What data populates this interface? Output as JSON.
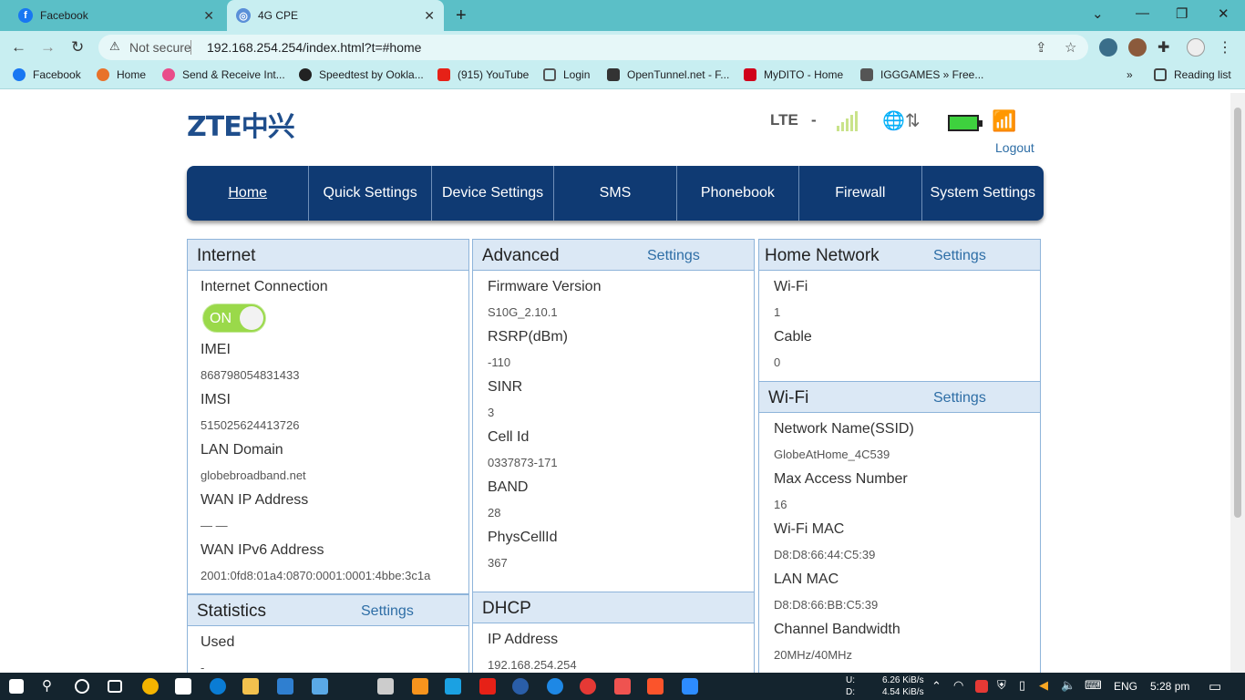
{
  "browser": {
    "tabs": [
      {
        "title": "Facebook",
        "active": false
      },
      {
        "title": "4G CPE",
        "active": true
      }
    ],
    "address": {
      "security": "Not secure",
      "url": "192.168.254.254/index.html?t=#home"
    },
    "bookmarks": [
      "Facebook",
      "Home",
      "Send & Receive Int...",
      "Speedtest by Ookla...",
      "(915) YouTube",
      "Login",
      "OpenTunnel.net - F...",
      "MyDITO - Home",
      "IGGGAMES » Free..."
    ],
    "reading_list": "Reading list"
  },
  "router": {
    "brand": "ZTE中兴",
    "network_type": "LTE",
    "network_sep": "-",
    "logout": "Logout",
    "menu": [
      "Home",
      "Quick Settings",
      "Device Settings",
      "SMS",
      "Phonebook",
      "Firewall",
      "System Settings"
    ]
  },
  "internet": {
    "title": "Internet",
    "connection_label": "Internet Connection",
    "toggle": "ON",
    "imei_label": "IMEI",
    "imei": "868798054831433",
    "imsi_label": "IMSI",
    "imsi": "515025624413726",
    "lan_domain_label": "LAN Domain",
    "lan_domain": "globebroadband.net",
    "wan_ip_label": "WAN IP Address",
    "wan_ip": "— —",
    "wan_ipv6_label": "WAN IPv6 Address",
    "wan_ipv6": "2001:0fd8:01a4:0870:0001:0001:4bbe:3c1a"
  },
  "statistics": {
    "title": "Statistics",
    "settings": "Settings",
    "used_label": "Used",
    "used": "-"
  },
  "advanced": {
    "title": "Advanced",
    "settings": "Settings",
    "fw_label": "Firmware Version",
    "fw": "S10G_2.10.1",
    "rsrp_label": "RSRP(dBm)",
    "rsrp": "-110",
    "sinr_label": "SINR",
    "sinr": "3",
    "cell_label": "Cell Id",
    "cell": "0337873-171",
    "band_label": "BAND",
    "band": "28",
    "pci_label": "PhysCellId",
    "pci": "367"
  },
  "dhcp": {
    "title": "DHCP",
    "ip_label": "IP Address",
    "ip": "192.168.254.254"
  },
  "home_network": {
    "title": "Home Network",
    "settings": "Settings",
    "wifi_label": "Wi-Fi",
    "wifi": "1",
    "cable_label": "Cable",
    "cable": "0"
  },
  "wifi": {
    "title": "Wi-Fi",
    "settings": "Settings",
    "ssid_label": "Network Name(SSID)",
    "ssid": "GlobeAtHome_4C539",
    "max_label": "Max Access Number",
    "max": "16",
    "wmac_label": "Wi-Fi MAC",
    "wmac": "D8:D8:66:44:C5:39",
    "lmac_label": "LAN MAC",
    "lmac": "D8:D8:66:BB:C5:39",
    "bw_label": "Channel Bandwidth",
    "bw": "20MHz/40MHz"
  },
  "taskbar": {
    "up_label": "U:",
    "up": "6.26 KiB/s",
    "down_label": "D:",
    "down": "4.54 KiB/s",
    "lang": "ENG",
    "time": "5:28 pm"
  },
  "colors": {
    "nav": "#0f3a73",
    "panel_head": "#dbe8f5",
    "toggle": "#9ad94a",
    "tabbar": "#5bbfc7"
  }
}
